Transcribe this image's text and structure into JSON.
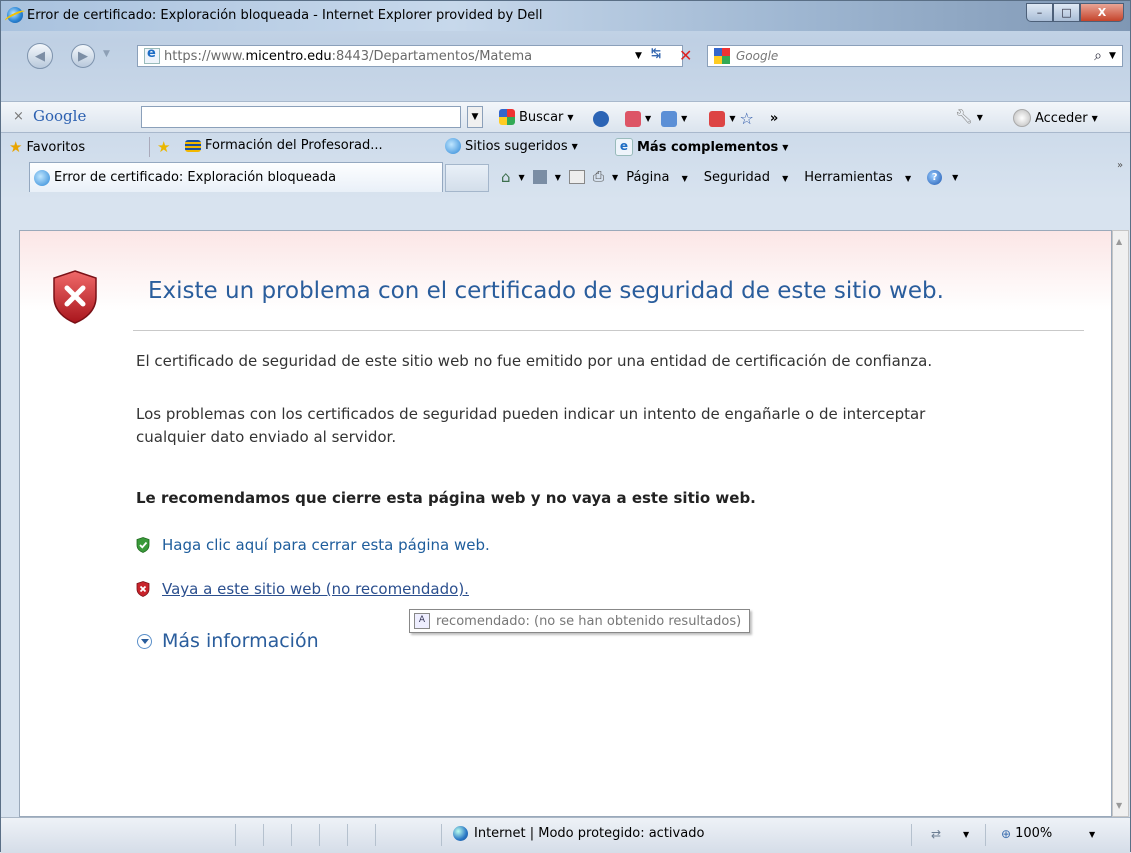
{
  "window": {
    "title": "Error de certificado: Exploración bloqueada - Internet Explorer provided by Dell",
    "minimize": "–",
    "maximize": "□",
    "close": "X"
  },
  "nav": {
    "url_prefix": "https://www.",
    "url_domain": "micentro.edu",
    "url_rest": ":8443/Departamentos/Matema",
    "search_placeholder": "Google"
  },
  "google_toolbar": {
    "close": "×",
    "logo": "Google",
    "search_label": "Buscar",
    "more": "»",
    "signin": "Acceder"
  },
  "favorites_bar": {
    "favorites": "Favoritos",
    "item1": "Formación del Profesorad...",
    "item2": "Sitios sugeridos",
    "item3": "Más complementos"
  },
  "tab": {
    "title": "Error de certificado: Exploración bloqueada"
  },
  "command_bar": {
    "page": "Página",
    "security": "Seguridad",
    "tools": "Herramientas",
    "more": "»"
  },
  "content": {
    "heading": "Existe un problema con el certificado de seguridad de este sitio web.",
    "p1": "El certificado de seguridad de este sitio web no fue emitido por una entidad de certificación de confianza.",
    "p2_line1": "Los problemas con los certificados de seguridad pueden indicar un intento de engañarle o de interceptar",
    "p2_line2": "cualquier dato enviado al servidor.",
    "recommend": "Le recomendamos que cierre esta página web y no vaya a este sitio web.",
    "link_close": "Haga clic aquí para cerrar esta página web.",
    "link_continue": "Vaya a este sitio web (no recomendado).",
    "more_info": "Más información",
    "tooltip": "recomendado: (no se han obtenido resultados)"
  },
  "status": {
    "zone": "Internet | Modo protegido: activado",
    "zoom": "100%"
  },
  "colors": {
    "heading": "#2a5d9c",
    "link": "#1e5d9c",
    "shield_red": "#c8232b",
    "shield_green": "#3a9a3a"
  }
}
